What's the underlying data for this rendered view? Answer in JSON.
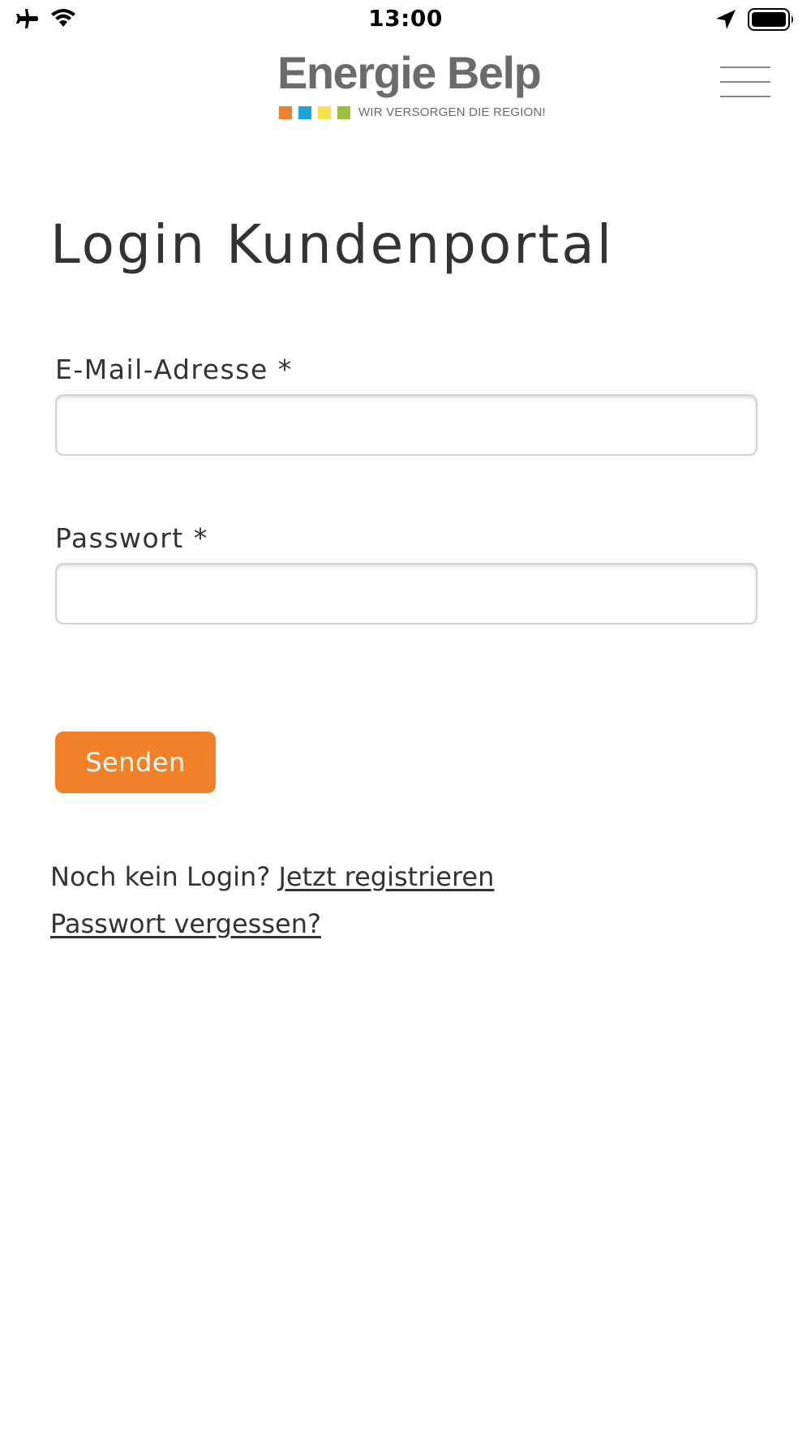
{
  "status_bar": {
    "time": "13:00",
    "left_icons": [
      "airplane-icon",
      "wifi-icon"
    ],
    "right_icons": [
      "location-arrow-icon",
      "battery-icon"
    ]
  },
  "header": {
    "logo": {
      "name": "Energie Belp",
      "tagline": "WIR VERSORGEN DIE REGION!",
      "square_colors": [
        "#f08128",
        "#1aa6d9",
        "#f7e04a",
        "#9cc23b"
      ]
    },
    "menu_icon": "hamburger-menu-icon"
  },
  "main": {
    "title": "Login Kundenportal",
    "email": {
      "label": "E-Mail-Adresse *",
      "value": ""
    },
    "password": {
      "label": "Passwort *",
      "value": ""
    },
    "submit_label": "Senden",
    "register_prompt": "Noch kein Login?",
    "register_link": "Jetzt registrieren",
    "forgot_link": "Passwort vergessen?"
  },
  "colors": {
    "accent": "#f08128",
    "text": "#333333",
    "logo_text": "#6b6b6b"
  }
}
